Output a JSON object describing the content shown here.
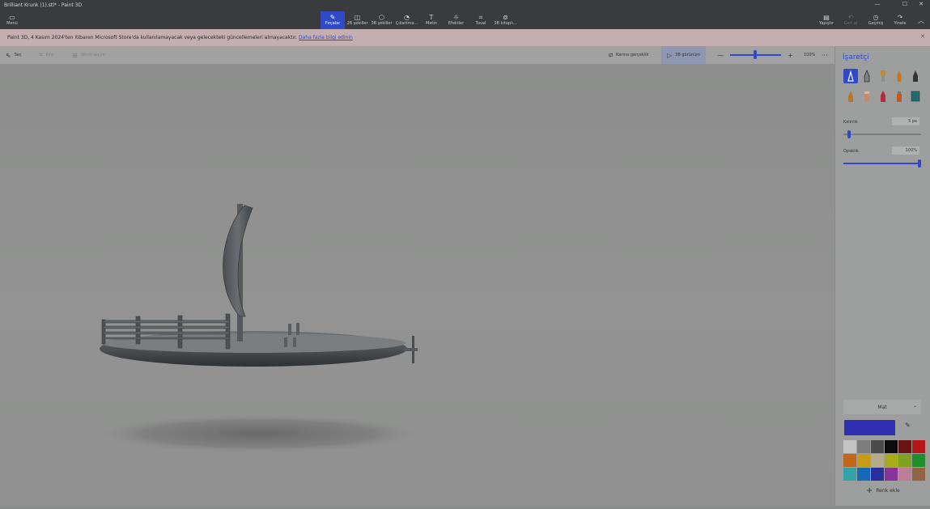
{
  "window": {
    "title": "Brilliant Krunk (1).stl* - Paint 3D",
    "minimize": "—",
    "maximize": "☐",
    "close": "✕"
  },
  "ribbon": {
    "menu": {
      "label": "Menü",
      "icon": "folder-icon"
    },
    "tools": [
      {
        "label": "Fırçalar",
        "icon": "brush-icon",
        "active": true
      },
      {
        "label": "2B şekiller",
        "icon": "2d-shapes-icon"
      },
      {
        "label": "3B şekiller",
        "icon": "3d-shapes-icon"
      },
      {
        "label": "Çıkartma...",
        "icon": "sticker-icon"
      },
      {
        "label": "Metin",
        "icon": "text-icon"
      },
      {
        "label": "Efektler",
        "icon": "effects-icon"
      },
      {
        "label": "Tuval",
        "icon": "canvas-icon"
      },
      {
        "label": "3B kitaplı...",
        "icon": "3d-library-icon"
      }
    ],
    "right": [
      {
        "label": "Yapıştır",
        "icon": "paste-icon",
        "enabled": true
      },
      {
        "label": "Geri al",
        "icon": "undo-icon",
        "enabled": false
      },
      {
        "label": "Geçmiş",
        "icon": "history-icon",
        "enabled": true
      },
      {
        "label": "Yinele",
        "icon": "redo-icon",
        "enabled": true
      }
    ],
    "collapse": "︿"
  },
  "notice": {
    "text": "Paint 3D, 4 Kasım 2024'ten itibaren Microsoft Store'da kullanılamayacak veya gelecekteki güncellemeleri almayacaktır.",
    "link": "Daha fazla bilgi edinin",
    "close": "✕"
  },
  "toolbar": {
    "select": "Seç",
    "crop": "Kırp",
    "magic_select": "Sihirli seçim",
    "mixed_reality": "Karma gerçeklik",
    "view_3d": "3B görünüm",
    "zoom_out": "—",
    "zoom_in": "+",
    "zoom": "100%",
    "zoom_fraction": 0.5,
    "more": "···"
  },
  "panel": {
    "title": "İşaretçi",
    "brushes": [
      {
        "name": "marker-brush-icon",
        "color": "#2f49c9",
        "active": true
      },
      {
        "name": "calligraphy-pen-icon",
        "color": "#555555"
      },
      {
        "name": "oil-brush-icon",
        "color": "#c68a2e"
      },
      {
        "name": "watercolor-icon",
        "color": "#c27a1e"
      },
      {
        "name": "pixel-pen-icon",
        "color": "#333333"
      },
      {
        "name": "pencil-icon",
        "color": "#b8762b"
      },
      {
        "name": "eraser-icon",
        "color": "#c8876f"
      },
      {
        "name": "crayon-icon",
        "color": "#b8283b"
      },
      {
        "name": "spray-can-icon",
        "color": "#c05a1a"
      },
      {
        "name": "fill-icon",
        "color": "#1f6b73"
      }
    ],
    "thickness_label": "Kalınlık",
    "thickness_value": "5 px",
    "thickness_fraction": 0.05,
    "opacity_label": "Opaklık",
    "opacity_value": "100%",
    "opacity_fraction": 1.0,
    "finish": "Mat",
    "current_color": "#2f2fb2",
    "swatches": [
      "#c4c4c4",
      "#7d7d7d",
      "#4a4a4a",
      "#0c0c0c",
      "#6b1212",
      "#b71616",
      "#c4661a",
      "#c99a13",
      "#b5ab86",
      "#a6ad17",
      "#7ea21d",
      "#1f8e2c",
      "#31a3a9",
      "#1768b6",
      "#2a2fa0",
      "#88339a",
      "#bb7d98",
      "#916443"
    ],
    "add_color": "Renk ekle"
  }
}
